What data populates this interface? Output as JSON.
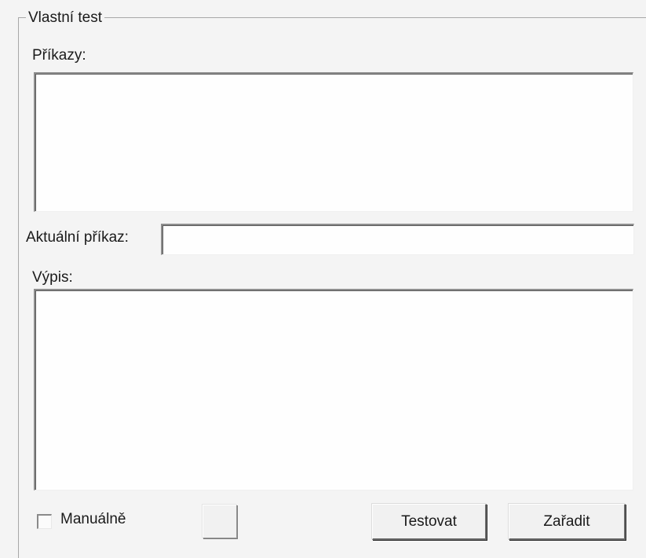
{
  "group": {
    "title": "Vlastní test"
  },
  "commands": {
    "label": "Příkazy:",
    "value": ""
  },
  "current_command": {
    "label": "Aktuální příkaz:",
    "value": ""
  },
  "output": {
    "label": "Výpis:",
    "value": ""
  },
  "manual": {
    "label": "Manuálně",
    "checked": false
  },
  "buttons": {
    "small_label": "",
    "test_label": "Testovat",
    "add_label": "Zařadit"
  }
}
